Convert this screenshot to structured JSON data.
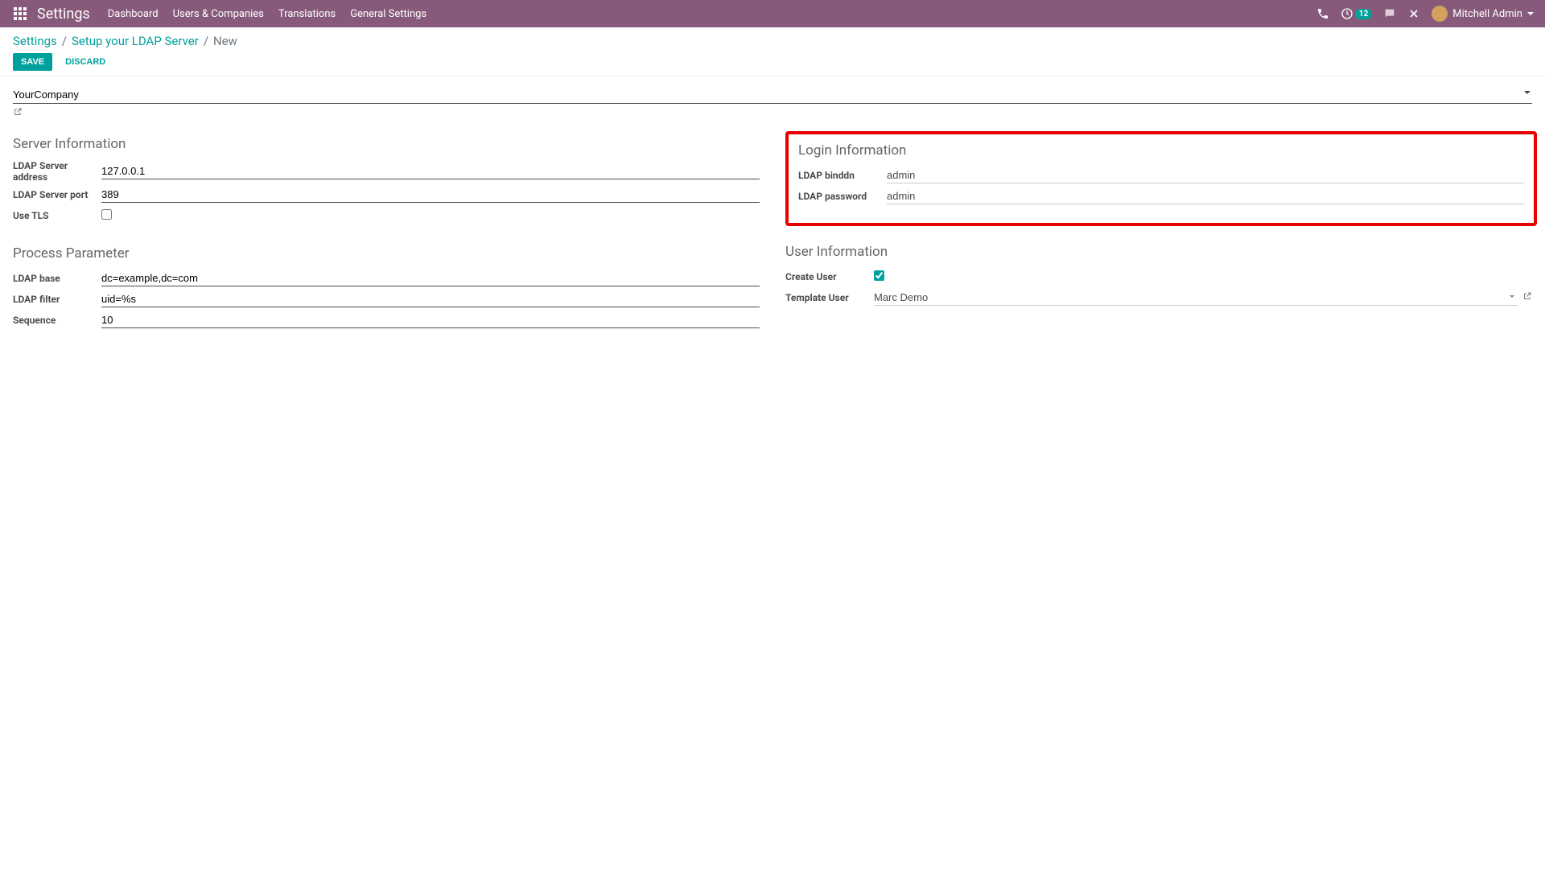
{
  "navbar": {
    "brand": "Settings",
    "menu": [
      "Dashboard",
      "Users & Companies",
      "Translations",
      "General Settings"
    ],
    "activity_count": "12",
    "user_name": "Mitchell Admin"
  },
  "breadcrumb": {
    "root": "Settings",
    "parent": "Setup your LDAP Server",
    "current": "New"
  },
  "buttons": {
    "save": "SAVE",
    "discard": "DISCARD"
  },
  "company": {
    "value": "YourCompany"
  },
  "sections": {
    "server": {
      "title": "Server Information",
      "address_label": "LDAP Server address",
      "address_value": "127.0.0.1",
      "port_label": "LDAP Server port",
      "port_value": "389",
      "tls_label": "Use TLS",
      "tls_checked": false
    },
    "login": {
      "title": "Login Information",
      "binddn_label": "LDAP binddn",
      "binddn_value": "admin",
      "password_label": "LDAP password",
      "password_value": "admin"
    },
    "process": {
      "title": "Process Parameter",
      "base_label": "LDAP base",
      "base_value": "dc=example,dc=com",
      "filter_label": "LDAP filter",
      "filter_value": "uid=%s",
      "sequence_label": "Sequence",
      "sequence_value": "10"
    },
    "user": {
      "title": "User Information",
      "create_label": "Create User",
      "create_checked": true,
      "template_label": "Template User",
      "template_value": "Marc Demo"
    }
  }
}
